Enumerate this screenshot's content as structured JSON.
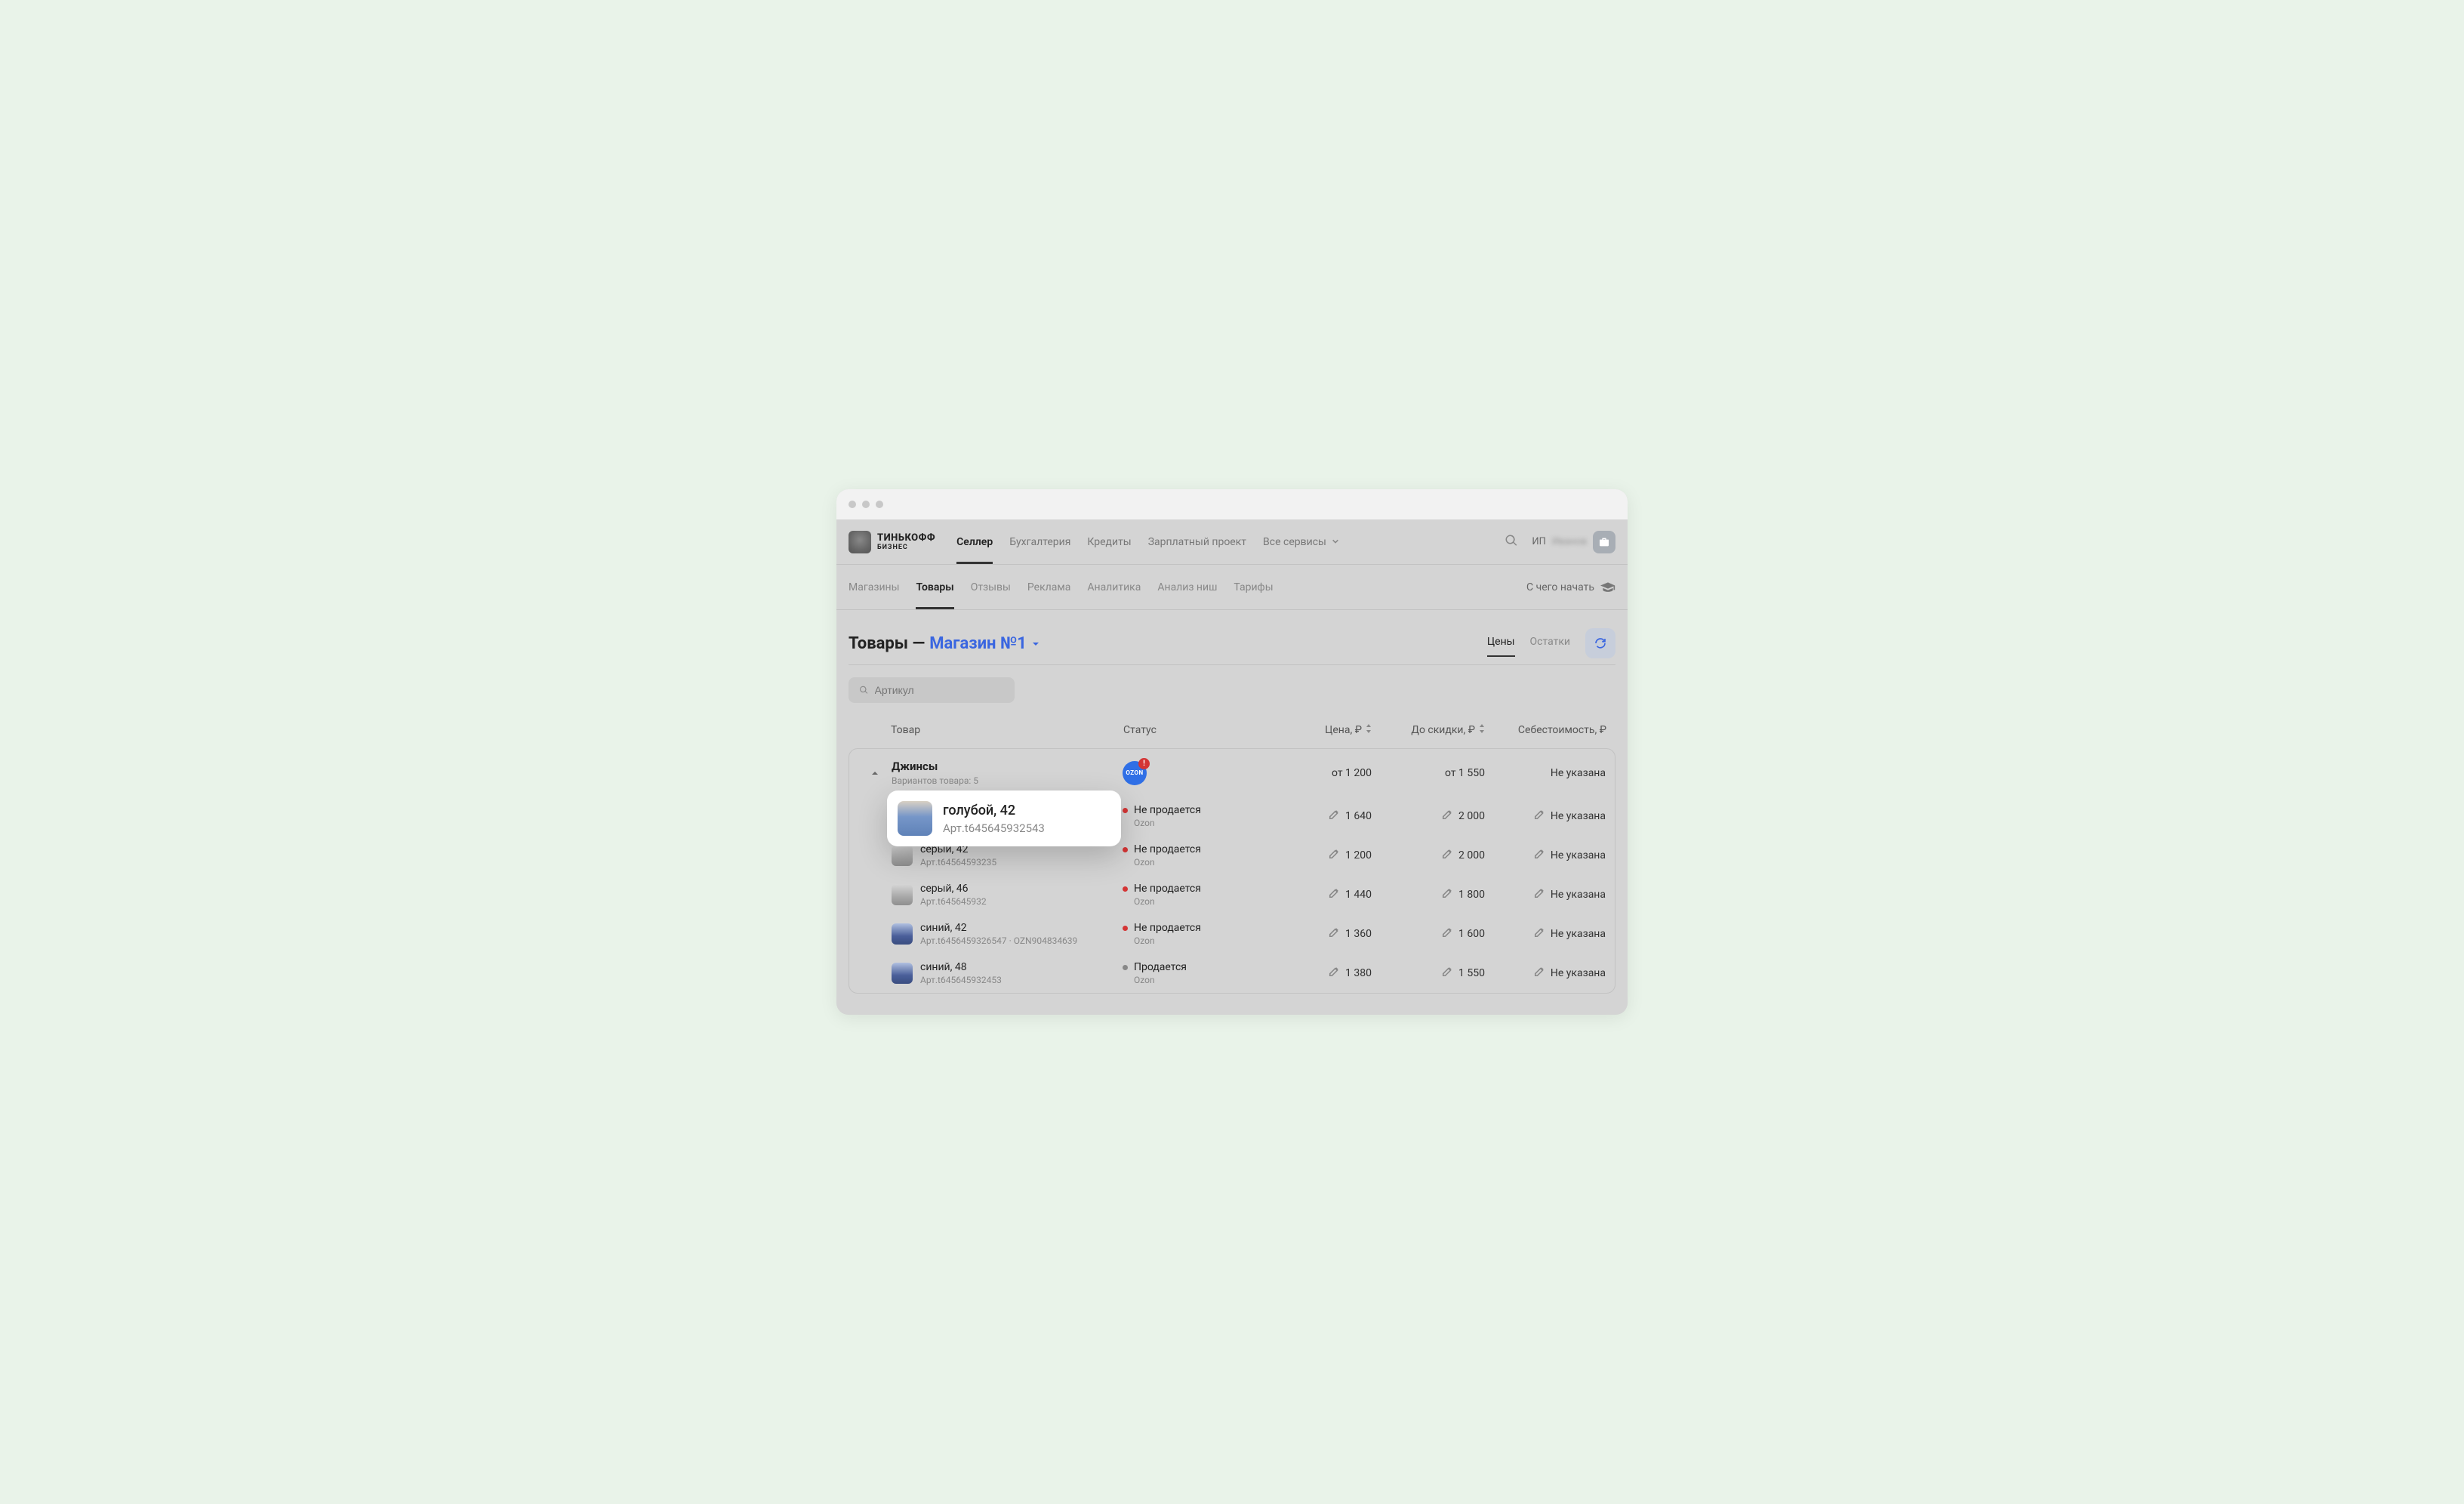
{
  "logo": {
    "title": "ТИНЬКОФФ",
    "sub": "БИЗНЕС"
  },
  "mainnav": {
    "items": [
      {
        "label": "Селлер",
        "active": true
      },
      {
        "label": "Бухгалтерия"
      },
      {
        "label": "Кредиты"
      },
      {
        "label": "Зарплатный проект"
      },
      {
        "label": "Все сервисы",
        "caret": true
      }
    ]
  },
  "account": {
    "prefix": "ИП",
    "blurred": "Иванов"
  },
  "subnav": {
    "items": [
      {
        "label": "Магазины"
      },
      {
        "label": "Товары",
        "active": true
      },
      {
        "label": "Отзывы"
      },
      {
        "label": "Реклама"
      },
      {
        "label": "Аналитика"
      },
      {
        "label": "Анализ ниш"
      },
      {
        "label": "Тарифы"
      }
    ],
    "help": "С чего начать"
  },
  "page": {
    "title_prefix": "Товары —",
    "store": "Магазин №1",
    "tabs": [
      {
        "label": "Цены",
        "active": true
      },
      {
        "label": "Остатки"
      }
    ]
  },
  "search": {
    "placeholder": "Артикул"
  },
  "columns": {
    "product": "Товар",
    "status": "Статус",
    "price": "Цена, ₽",
    "before_discount": "До скидки, ₽",
    "cost": "Себестоимость, ₽"
  },
  "group": {
    "name": "Джинсы",
    "variants_label": "Вариантов товара: 5",
    "marketplace": "OZON",
    "alert": "!",
    "price": "от 1 200",
    "before_discount": "от 1 550",
    "cost": "Не указана"
  },
  "rows": [
    {
      "name": "голубой, 42",
      "sku": "Арт.t645645932543",
      "status": "Не продается",
      "status_color": "red",
      "store": "Ozon",
      "price": "1 640",
      "before_discount": "2 000",
      "cost": "Не указана",
      "thumb": "blue",
      "popover": true
    },
    {
      "name": "серый, 42",
      "sku": "Арт.t64564593235",
      "status": "Не продается",
      "status_color": "red",
      "store": "Ozon",
      "price": "1 200",
      "before_discount": "2 000",
      "cost": "Не указана",
      "thumb": "grey"
    },
    {
      "name": "серый, 46",
      "sku": "Арт.t645645932",
      "status": "Не продается",
      "status_color": "red",
      "store": "Ozon",
      "price": "1 440",
      "before_discount": "1 800",
      "cost": "Не указана",
      "thumb": "grey"
    },
    {
      "name": "синий, 42",
      "sku": "Арт.t6456459326547 · OZN904834639",
      "status": "Не продается",
      "status_color": "red",
      "store": "Ozon",
      "price": "1 360",
      "before_discount": "1 600",
      "cost": "Не указана",
      "thumb": "darkblue"
    },
    {
      "name": "синий, 48",
      "sku": "Арт.t645645932453",
      "status": "Продается",
      "status_color": "grey",
      "store": "Ozon",
      "price": "1 380",
      "before_discount": "1 550",
      "cost": "Не указана",
      "thumb": "darkblue"
    }
  ],
  "popover": {
    "title": "голубой, 42",
    "sub": "Арт.t645645932543"
  }
}
